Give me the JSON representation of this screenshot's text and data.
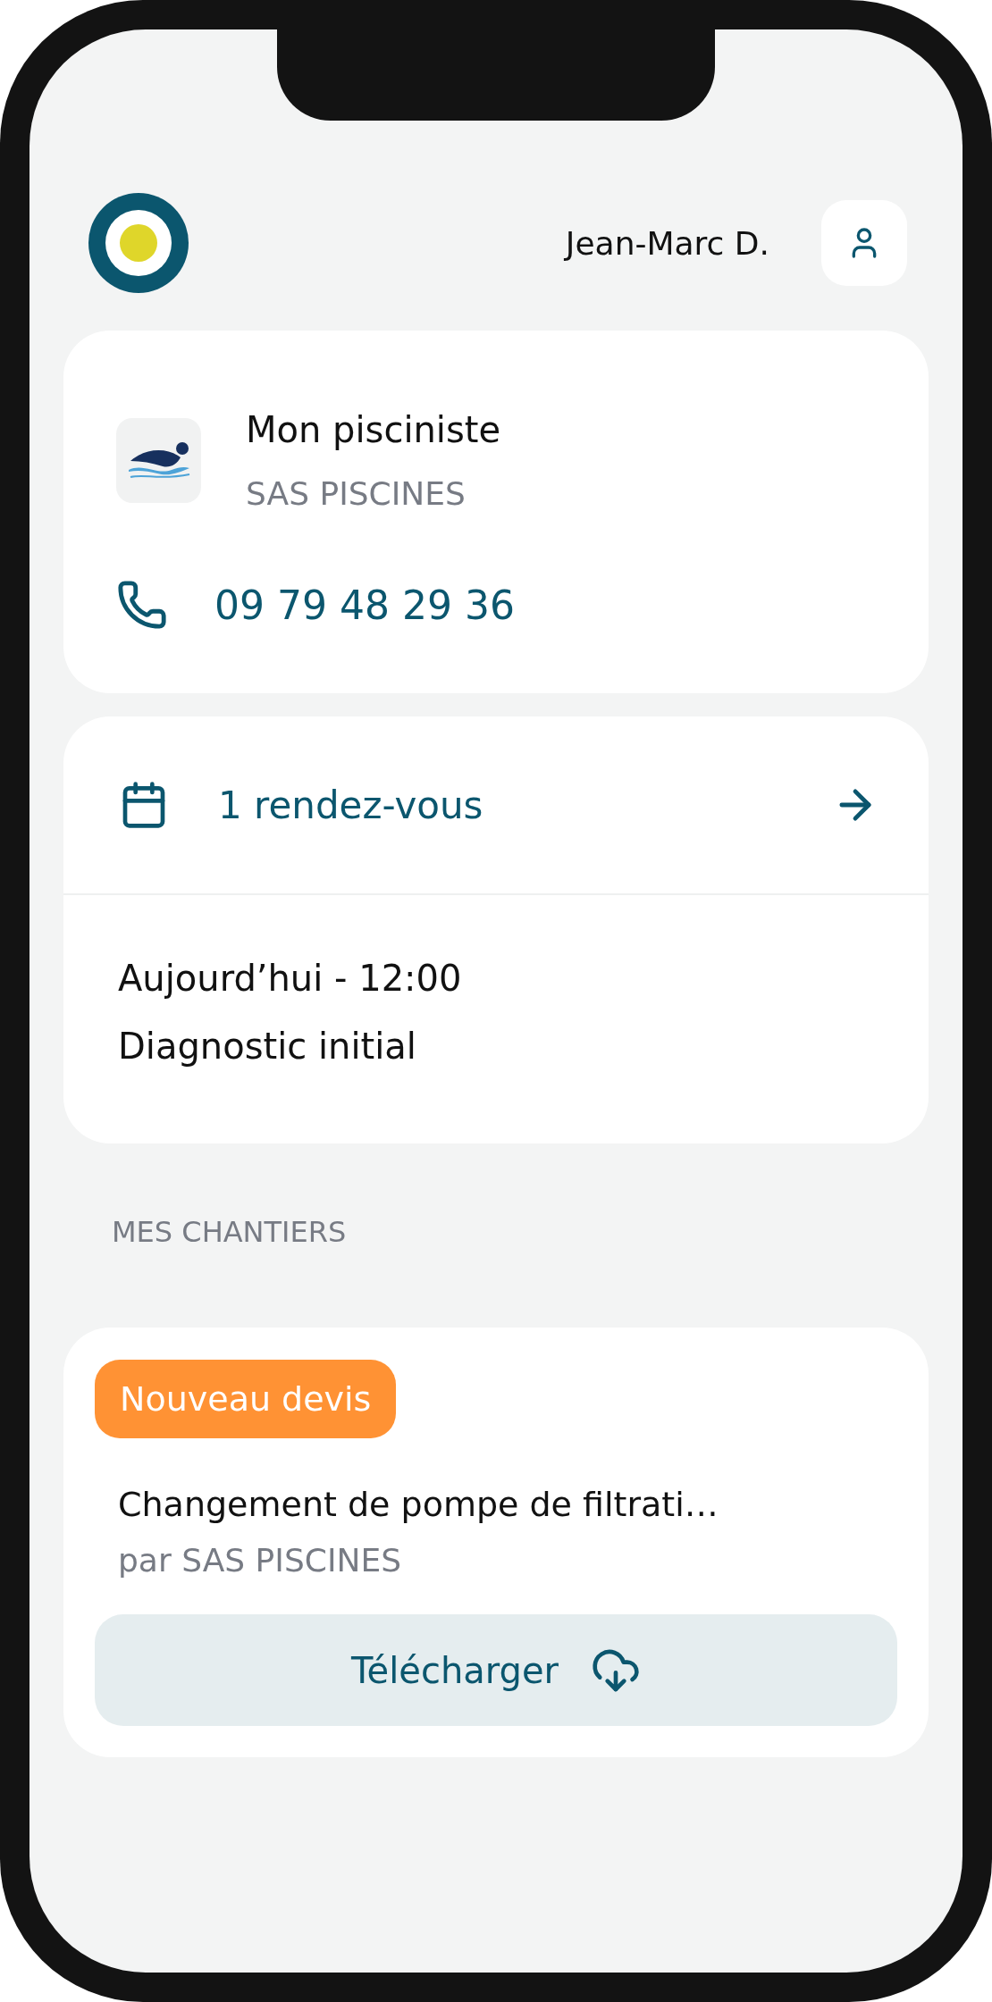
{
  "header": {
    "user_name": "Jean-Marc D."
  },
  "contractor_card": {
    "title": "Mon pisciniste",
    "company": "SAS PISCINES",
    "phone": "09 79 48 29 36"
  },
  "appointments_card": {
    "summary": "1 rendez-vous",
    "items": [
      {
        "when": "Aujourd’hui - 12:00",
        "title": "Diagnostic initial"
      }
    ]
  },
  "section_label": "MES CHANTIERS",
  "projects": [
    {
      "badge": "Nouveau devis",
      "title": "Changement de pompe de filtrati…",
      "by": "par SAS PISCINES",
      "action": "Télécharger"
    }
  ]
}
